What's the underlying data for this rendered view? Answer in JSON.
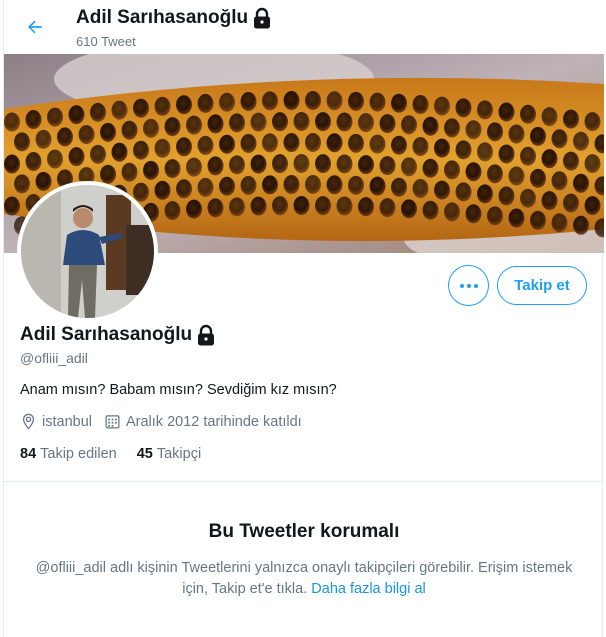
{
  "header": {
    "name": "Adil Sarıhasanoğlu",
    "tweet_count": "610 Tweet"
  },
  "profile": {
    "name": "Adil Sarıhasanoğlu",
    "handle": "@ofliii_adil",
    "bio": "Anam mısın? Babam mısın? Sevdiğim kız mısın?",
    "location": "istanbul",
    "joined": "Aralık 2012 tarihinde katıldı",
    "following_count": "84",
    "following_label": "Takip edilen",
    "followers_count": "45",
    "followers_label": "Takipçi",
    "follow_button": "Takip et"
  },
  "protected": {
    "title": "Bu Tweetler korumalı",
    "text": "@ofliii_adil adlı kişinin Tweetlerini yalnızca onaylı takipçileri görebilir. Erişim istemek için, Takip et'e tıkla.",
    "link": "Daha fazla bilgi al"
  },
  "icons": {
    "back": "arrow-left-icon",
    "lock": "lock-icon",
    "more": "more-dots-icon",
    "location": "location-pin-icon",
    "calendar": "calendar-icon"
  },
  "colors": {
    "accent": "#1da1f2",
    "secondary_text": "#657786",
    "primary_text": "#14171a"
  }
}
